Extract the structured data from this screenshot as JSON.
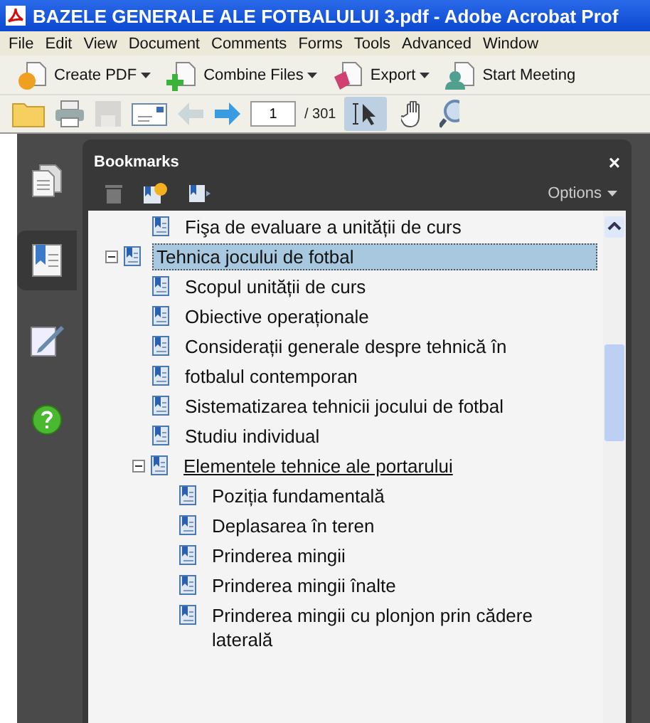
{
  "window": {
    "title": "BAZELE GENERALE ALE FOTBALULUI 3.pdf - Adobe Acrobat Prof"
  },
  "menu": [
    "File",
    "Edit",
    "View",
    "Document",
    "Comments",
    "Forms",
    "Tools",
    "Advanced",
    "Window"
  ],
  "task_toolbar": [
    {
      "label": "Create PDF",
      "kind": "create"
    },
    {
      "label": "Combine Files",
      "kind": "combine"
    },
    {
      "label": "Export",
      "kind": "export"
    },
    {
      "label": "Start Meeting",
      "kind": "meeting"
    }
  ],
  "nav_toolbar": {
    "tools": [
      {
        "kind": "open",
        "disabled": false
      },
      {
        "kind": "print",
        "disabled": false
      },
      {
        "kind": "save",
        "disabled": true
      },
      {
        "kind": "email",
        "disabled": false
      },
      {
        "kind": "back",
        "disabled": true
      },
      {
        "kind": "forward",
        "disabled": false
      }
    ],
    "page": "1",
    "page_total": "/ 301",
    "modes": [
      {
        "kind": "select",
        "selected": true
      },
      {
        "kind": "hand",
        "selected": false
      },
      {
        "kind": "zoom",
        "selected": false
      }
    ]
  },
  "side_tabs": [
    {
      "kind": "pages",
      "selected": false
    },
    {
      "kind": "bookmarks",
      "selected": true
    },
    {
      "kind": "signatures",
      "selected": false
    },
    {
      "kind": "help",
      "selected": false
    }
  ],
  "bookmarks": {
    "title": "Bookmarks",
    "close": "×",
    "options": "Options",
    "continued_items": [
      {
        "label": "Fişa de evaluare a unității de curs",
        "selected": false,
        "hovered": false
      }
    ],
    "items": [
      {
        "label": "Tehnica jocului de fotbal",
        "selected": true,
        "hovered": false,
        "expanded": true,
        "children": [
          {
            "label": "Scopul unității de curs",
            "selected": false,
            "hovered": false
          },
          {
            "label": "Obiective operaționale",
            "selected": false,
            "hovered": false
          },
          {
            "label": "Considerații generale despre tehnică în",
            "selected": false,
            "hovered": false
          },
          {
            "label": "fotbalul contemporan",
            "selected": false,
            "hovered": false
          },
          {
            "label": "Sistematizarea tehnicii jocului de fotbal",
            "selected": false,
            "hovered": false
          },
          {
            "label": "Studiu individual",
            "selected": false,
            "hovered": false
          },
          {
            "label": "Elementele tehnice ale portarului",
            "selected": false,
            "hovered": true,
            "expanded": true,
            "children": [
              {
                "label": "Poziția fundamentală",
                "selected": false,
                "hovered": false
              },
              {
                "label": "Deplasarea în teren",
                "selected": false,
                "hovered": false
              },
              {
                "label": "Prinderea mingii",
                "selected": false,
                "hovered": false
              },
              {
                "label": "Prinderea mingii înalte",
                "selected": false,
                "hovered": false
              },
              {
                "label": "Prinderea mingii cu plonjon prin cădere laterală",
                "selected": false,
                "hovered": false
              }
            ]
          }
        ]
      }
    ]
  }
}
